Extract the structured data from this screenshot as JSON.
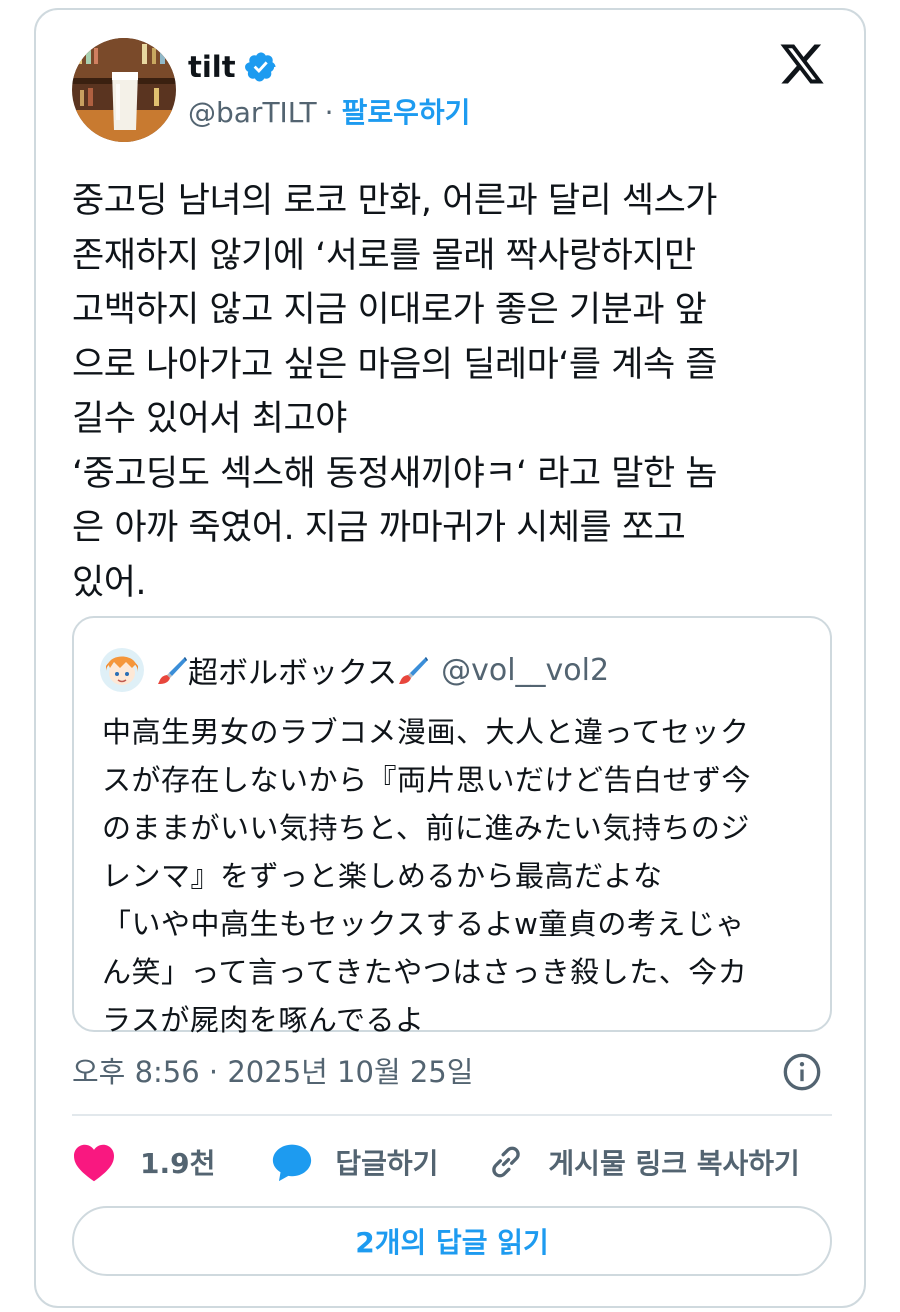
{
  "author": {
    "name": "tilt",
    "handle": "@barTILT",
    "separator": "·",
    "follow_label": "팔로우하기",
    "verified": true
  },
  "tweet": {
    "text": "중고딩 남녀의 로코 만화, 어른과 달리 섹스가\n존재하지 않기에 ‘서로를 몰래 짝사랑하지만\n고백하지 않고 지금 이대로가 좋은 기분과 앞\n으로 나아가고 싶은 마음의 딜레마‘를 계속 즐\n길수 있어서 최고야\n‘중고딩도 섹스해 동정새끼야ㅋ‘ 라고 말한 놈\n은 아까 죽였어. 지금 까마귀가 시체를 쪼고\n있어."
  },
  "quote": {
    "name": "超ボルボックス",
    "handle": "@vol__vol2",
    "text": "中高生男女のラブコメ漫画、大人と違ってセック\nスが存在しないから『両片思いだけど告白せず今\nのままがいい気持ちと、前に進みたい気持ちのジ\nレンマ』をずっと楽しめるから最高だよな\n「いや中高生もセックスするよw童貞の考えじゃ\nん笑」って言ってきたやつはさっき殺した、今カ\nラスが屍肉を啄んでるよ"
  },
  "timestamp": "오후 8:56 · 2025년 10월 25일",
  "actions": {
    "like_count": "1.9천",
    "reply_label": "답글하기",
    "copy_link_label": "게시물 링크 복사하기"
  },
  "read_replies_label": "2개의 답글 읽기",
  "colors": {
    "accent": "#1d9bf0",
    "like": "#f91880",
    "text": "#0f1419",
    "muted": "#536471",
    "border": "#cfd9de"
  },
  "icons": {
    "close": "x-logo-icon",
    "verified": "verified-badge-icon",
    "info": "info-icon",
    "like": "heart-icon",
    "reply": "speech-bubble-icon",
    "copy": "link-icon",
    "brush": "paintbrush-icon"
  }
}
